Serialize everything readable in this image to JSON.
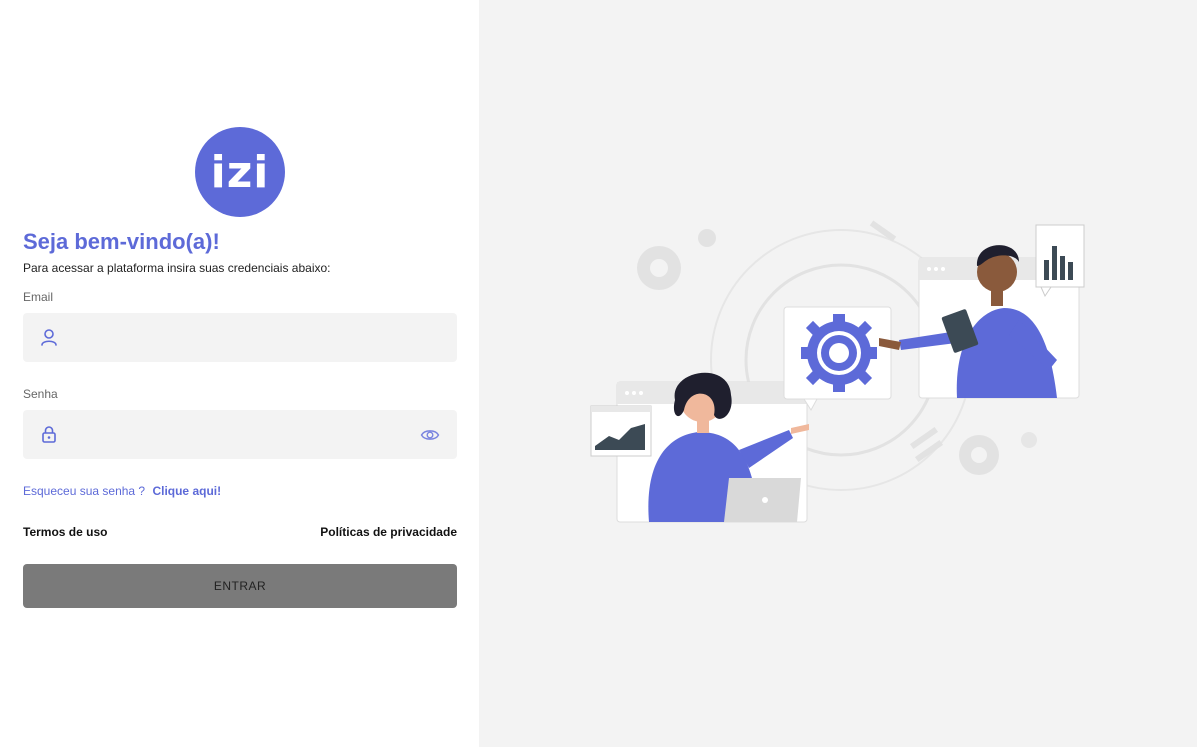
{
  "brand": {
    "logo_text": "izi",
    "accent_color": "#5d6ad8"
  },
  "login": {
    "welcome_title": "Seja bem-vindo(a)!",
    "subtitle": "Para acessar a plataforma insira suas credenciais abaixo:",
    "email": {
      "label": "Email",
      "value": "",
      "placeholder": "",
      "icon": "user-icon"
    },
    "password": {
      "label": "Senha",
      "value": "",
      "placeholder": "",
      "icon": "lock-icon",
      "toggle_icon": "eye-icon"
    },
    "forgot": {
      "text": "Esqueceu sua senha ?",
      "link": "Clique aqui!"
    },
    "terms_link": "Termos de uso",
    "privacy_link": "Políticas de privacidade",
    "submit_label": "ENTRAR"
  },
  "illustration": {
    "name": "team-settings-illustration"
  }
}
